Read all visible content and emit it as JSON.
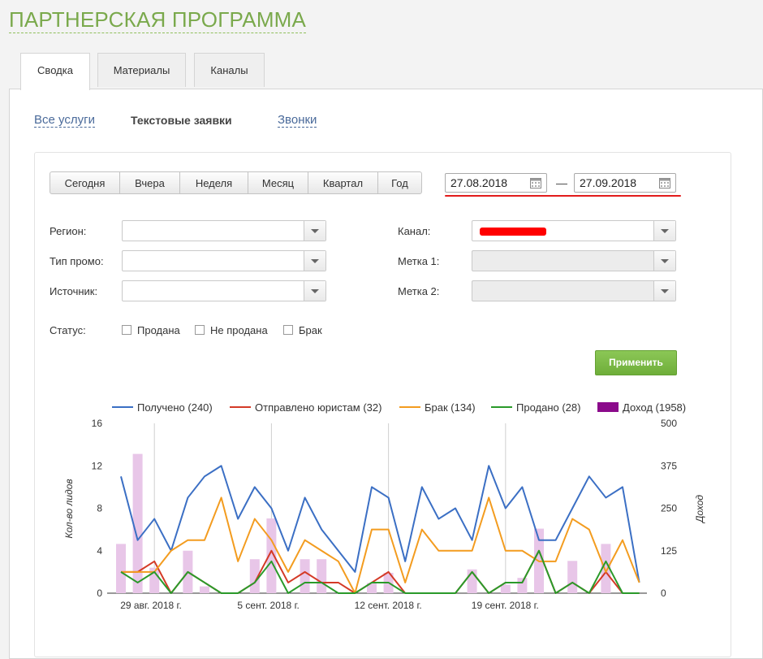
{
  "page": {
    "title": "ПАРТНЕРСКАЯ ПРОГРАММА"
  },
  "tabs": [
    {
      "label": "Сводка",
      "active": true
    },
    {
      "label": "Материалы",
      "active": false
    },
    {
      "label": "Каналы",
      "active": false
    }
  ],
  "subnav": [
    {
      "label": "Все услуги",
      "active": false
    },
    {
      "label": "Текстовые заявки",
      "active": true
    },
    {
      "label": "Звонки",
      "active": false
    }
  ],
  "periods": [
    "Сегодня",
    "Вчера",
    "Неделя",
    "Месяц",
    "Квартал",
    "Год"
  ],
  "date_range": {
    "from": "27.08.2018",
    "separator": "—",
    "to": "27.09.2018"
  },
  "filters": {
    "region": {
      "label": "Регион:",
      "value": ""
    },
    "promo_type": {
      "label": "Тип промо:",
      "value": ""
    },
    "source": {
      "label": "Источник:",
      "value": ""
    },
    "channel": {
      "label": "Канал:",
      "value": ""
    },
    "tag1": {
      "label": "Метка 1:",
      "value": ""
    },
    "tag2": {
      "label": "Метка 2:",
      "value": ""
    }
  },
  "status": {
    "label": "Статус:",
    "options": [
      "Продана",
      "Не продана",
      "Брак"
    ]
  },
  "apply_label": "Применить",
  "colors": {
    "received": "#3b6fc4",
    "sent": "#d43a27",
    "defect": "#f39c1f",
    "sold": "#2a9a2a",
    "income_legend": "#8b0a8b",
    "income_bar": "#e8c6e8"
  },
  "chart_data": {
    "type": "line",
    "ylabel": "Кол-во лидов",
    "y2label": "Доход",
    "ylim": [
      0,
      16
    ],
    "y2lim": [
      0,
      500
    ],
    "yticks": [
      0,
      4,
      8,
      12,
      16
    ],
    "y2ticks": [
      0,
      125,
      250,
      375,
      500
    ],
    "xtick_labels": [
      {
        "label": "29 авг. 2018 г.",
        "day": 2
      },
      {
        "label": "5 сент. 2018 г.",
        "day": 9
      },
      {
        "label": "12 сент. 2018 г.",
        "day": 16
      },
      {
        "label": "19 сент. 2018 г.",
        "day": 23
      }
    ],
    "x_days": 32,
    "legend": [
      {
        "name": "Получено (240)",
        "key": "received"
      },
      {
        "name": "Отправлено юристам (32)",
        "key": "sent"
      },
      {
        "name": "Брак (134)",
        "key": "defect"
      },
      {
        "name": "Продано (28)",
        "key": "sold"
      },
      {
        "name": "Доход (1958)",
        "key": "income_legend"
      }
    ],
    "series": [
      {
        "key": "received",
        "values": [
          11,
          5,
          7,
          4,
          9,
          11,
          12,
          7,
          10,
          8,
          4,
          9,
          6,
          4,
          2,
          10,
          9,
          3,
          10,
          7,
          8,
          5,
          12,
          8,
          10,
          5,
          5,
          8,
          11,
          9,
          10,
          1
        ]
      },
      {
        "key": "sent",
        "values": [
          2,
          2,
          3,
          0,
          2,
          1,
          0,
          0,
          1,
          4,
          1,
          2,
          1,
          1,
          0,
          1,
          2,
          0,
          0,
          0,
          0,
          2,
          0,
          1,
          1,
          4,
          0,
          1,
          0,
          2,
          0,
          0
        ]
      },
      {
        "key": "defect",
        "values": [
          2,
          2,
          2,
          4,
          5,
          5,
          9,
          3,
          7,
          5,
          2,
          5,
          4,
          3,
          0,
          6,
          6,
          1,
          6,
          4,
          4,
          4,
          9,
          4,
          4,
          3,
          3,
          7,
          6,
          2,
          5,
          1
        ]
      },
      {
        "key": "sold",
        "values": [
          2,
          1,
          2,
          0,
          2,
          1,
          0,
          0,
          1,
          3,
          0,
          1,
          1,
          0,
          0,
          1,
          1,
          0,
          0,
          0,
          0,
          2,
          0,
          1,
          1,
          4,
          0,
          1,
          0,
          3,
          0,
          0
        ]
      }
    ],
    "income": [
      145,
      410,
      75,
      0,
      125,
      20,
      0,
      0,
      100,
      220,
      0,
      100,
      100,
      0,
      0,
      30,
      60,
      0,
      0,
      0,
      0,
      70,
      0,
      25,
      45,
      190,
      0,
      95,
      0,
      145,
      0,
      0
    ]
  }
}
